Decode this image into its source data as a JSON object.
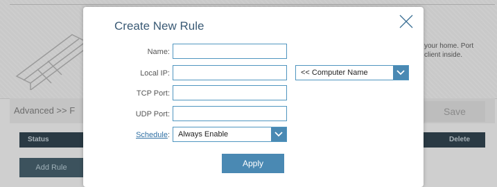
{
  "background": {
    "description_text": "your home. Port client inside.",
    "description_line1": "your home. Port",
    "description_line2": "client inside.",
    "breadcrumb": "Advanced >> F",
    "save_label": "Save",
    "table_headers": {
      "status": "Status",
      "delete": "Delete"
    },
    "add_rule_label": "Add Rule"
  },
  "modal": {
    "title": "Create New Rule",
    "close_icon": "close-icon",
    "fields": {
      "name": {
        "label": "Name:",
        "value": ""
      },
      "local_ip": {
        "label": "Local IP:",
        "value": ""
      },
      "tcp_port": {
        "label": "TCP Port:",
        "value": ""
      },
      "udp_port": {
        "label": "UDP Port:",
        "value": ""
      }
    },
    "computer_name_select": {
      "selected": "<< Computer Name"
    },
    "schedule": {
      "label": "Schedule",
      "colon": ":",
      "selected": "Always Enable"
    },
    "apply_label": "Apply"
  },
  "colors": {
    "accent": "#4a89b3",
    "title": "#3a5a75",
    "link": "#2f6fa3",
    "overlay_dark": "#2a3a44"
  }
}
